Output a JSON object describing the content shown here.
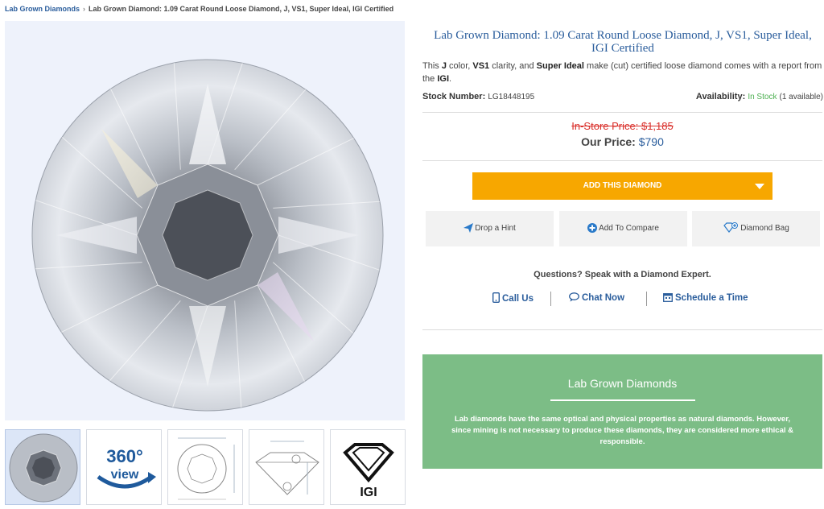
{
  "breadcrumb": {
    "link": "Lab Grown Diamonds",
    "separator": "›",
    "current": "Lab Grown Diamond: 1.09 Carat Round Loose Diamond, J, VS1, Super Ideal, IGI Certified"
  },
  "product": {
    "title": "Lab Grown Diamond: 1.09 Carat Round Loose Diamond, J, VS1, Super Ideal, IGI Certified",
    "desc": {
      "p1": "This ",
      "color": "J",
      "p2": " color, ",
      "clarity": "VS1",
      "p3": " clarity, and ",
      "cut": "Super Ideal",
      "p4": " make (cut) certified loose diamond comes with a report from the ",
      "lab": "IGI",
      "p5": "."
    },
    "stock_label": "Stock Number:",
    "stock_number": "LG18448195",
    "availability_label": "Availability:",
    "availability_status": "In Stock",
    "availability_count": "(1 available)"
  },
  "pricing": {
    "instore_label": "In-Store Price: $1,185",
    "our_label": "Our Price:",
    "our_value": "$790"
  },
  "actions": {
    "add_label": "ADD THIS DIAMOND",
    "hint_label": "Drop a Hint",
    "compare_label": "Add To Compare",
    "bag_label": "Diamond Bag"
  },
  "contact": {
    "question": "Questions? Speak with a Diamond Expert.",
    "call": "Call Us",
    "chat": "Chat Now",
    "schedule": "Schedule a Time"
  },
  "promo": {
    "title": "Lab Grown Diamonds",
    "text": "Lab diamonds have the same optical and physical properties as natural diamonds. However, since mining is not necessary to produce these diamonds, they are considered more ethical & responsible."
  },
  "thumbnails": {
    "view360_top": "360°",
    "view360_bottom": "view",
    "cert_logo_text": "IGI"
  },
  "colors": {
    "link_blue": "#2a5d9c",
    "accent_orange": "#f7a700",
    "sale_red": "#d9302b",
    "in_stock_green": "#4caf50",
    "promo_green": "#7cbd86"
  },
  "icons": {
    "hint": "paper-plane-icon",
    "compare": "plus-circle-icon",
    "bag": "diamond-heart-icon",
    "call": "phone-icon",
    "chat": "chat-bubble-icon",
    "schedule": "calendar-icon"
  }
}
